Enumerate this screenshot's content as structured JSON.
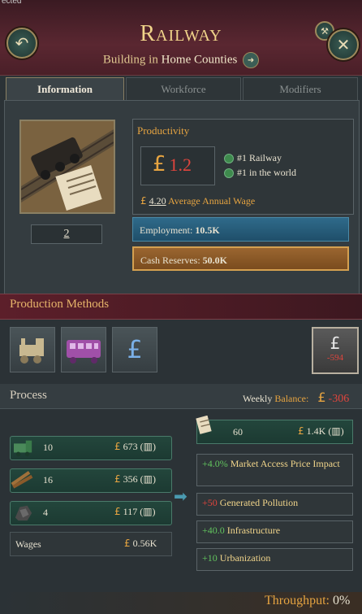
{
  "window": {
    "corner_text": "ected",
    "title": "Railway",
    "subtitle_type": "Building",
    "subtitle_in": "in",
    "subtitle_location": "Home Counties"
  },
  "tabs": [
    {
      "label": "Information",
      "active": true
    },
    {
      "label": "Workforce",
      "active": false
    },
    {
      "label": "Modifiers",
      "active": false
    }
  ],
  "info": {
    "level": "2",
    "productivity_label": "Productivity",
    "productivity_value": "1.2",
    "rank_national": "#1 Railway",
    "rank_world": "#1 in the world",
    "wage_value": "4.20",
    "wage_label": "Average Annual Wage",
    "employment_label": "Employment:",
    "employment_value": "10.5K",
    "cash_label": "Cash Reserves:",
    "cash_value": "50.0K"
  },
  "production_methods": {
    "title": "Production Methods",
    "icons": [
      "steam-locomotive-icon",
      "passenger-carriage-icon",
      "pound-hand-icon"
    ],
    "alert_value": "-594"
  },
  "process": {
    "title": "Process",
    "weekly_balance_label": "Weekly",
    "weekly_balance_word": "Balance:",
    "weekly_balance_value": "-306",
    "inputs": [
      {
        "icon": "engines-icon",
        "qty": "10",
        "cost": "673"
      },
      {
        "icon": "wood-icon",
        "qty": "16",
        "cost": "356"
      },
      {
        "icon": "coal-icon",
        "qty": "4",
        "cost": "117"
      }
    ],
    "wages_label": "Wages",
    "wages_value": "0.56K",
    "output": {
      "icon": "transportation-icon",
      "qty": "60",
      "value": "1.4K"
    },
    "effects": [
      {
        "value": "+4.0%",
        "text": "Market Access Price Impact",
        "kind": "plus"
      },
      {
        "value": "+50",
        "text": "Generated Pollution",
        "kind": "minus"
      },
      {
        "value": "+40.0",
        "text": "Infrastructure",
        "kind": "plus"
      },
      {
        "value": "+10",
        "text": "Urbanization",
        "kind": "plus"
      }
    ],
    "throughput_label": "Throughput:",
    "throughput_value": "0%"
  },
  "colors": {
    "header_bg": "#5a2731",
    "gold": "#f0d48a",
    "negative": "#e0453d",
    "positive": "#62c45e",
    "employment_bar": "#2f6a8a",
    "cash_bar": "#9a6630"
  }
}
